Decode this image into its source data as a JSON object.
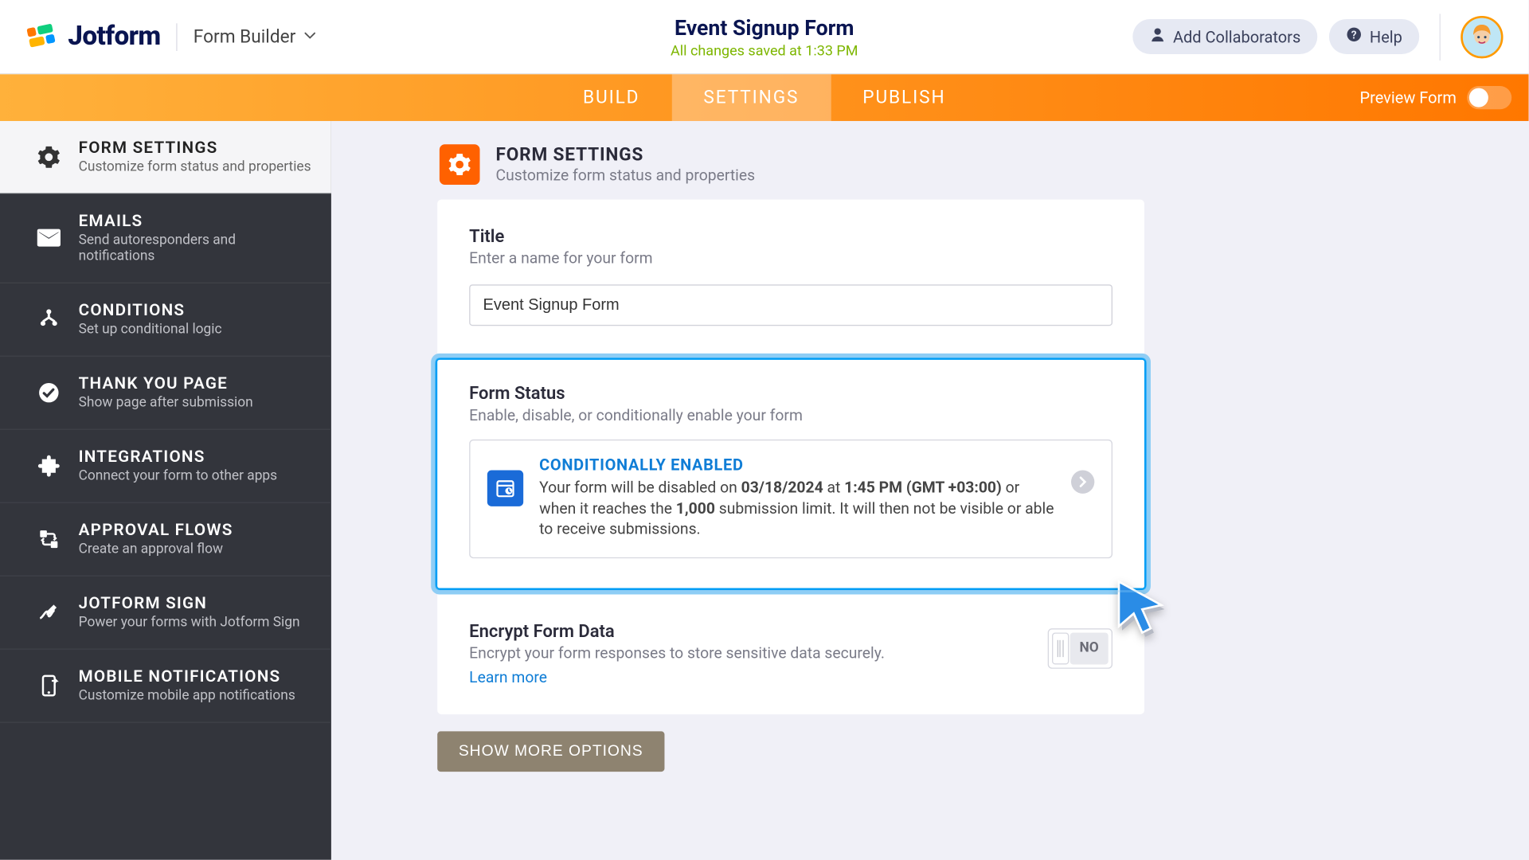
{
  "header": {
    "brand": "Jotform",
    "breadcrumb": "Form Builder",
    "form_title": "Event Signup Form",
    "saved_text": "All changes saved at 1:33 PM",
    "collaborators": "Add Collaborators",
    "help": "Help"
  },
  "tabs": {
    "build": "BUILD",
    "settings": "SETTINGS",
    "publish": "PUBLISH",
    "preview": "Preview Form"
  },
  "sidebar": [
    {
      "title": "FORM SETTINGS",
      "sub": "Customize form status and properties"
    },
    {
      "title": "EMAILS",
      "sub": "Send autoresponders and notifications"
    },
    {
      "title": "CONDITIONS",
      "sub": "Set up conditional logic"
    },
    {
      "title": "THANK YOU PAGE",
      "sub": "Show page after submission"
    },
    {
      "title": "INTEGRATIONS",
      "sub": "Connect your form to other apps"
    },
    {
      "title": "APPROVAL FLOWS",
      "sub": "Create an approval flow"
    },
    {
      "title": "JOTFORM SIGN",
      "sub": "Power your forms with Jotform Sign"
    },
    {
      "title": "MOBILE NOTIFICATIONS",
      "sub": "Customize mobile app notifications"
    }
  ],
  "content": {
    "header_title": "FORM SETTINGS",
    "header_sub": "Customize form status and properties",
    "title_label": "Title",
    "title_hint": "Enter a name for your form",
    "title_value": "Event Signup Form",
    "status_label": "Form Status",
    "status_hint": "Enable, disable, or conditionally enable your form",
    "status_box": {
      "title": "CONDITIONALLY ENABLED",
      "prefix": "Your form will be disabled on ",
      "date": "03/18/2024",
      "at": " at ",
      "time": "1:45 PM (GMT +03:00)",
      "mid": " or when it reaches the ",
      "limit": "1,000",
      "suffix": " submission limit. It will then not be visible or able to receive submissions."
    },
    "encrypt_label": "Encrypt Form Data",
    "encrypt_hint": "Encrypt your form responses to store sensitive data securely.",
    "learn_more": "Learn more",
    "encrypt_toggle": "NO",
    "show_more": "SHOW MORE OPTIONS"
  }
}
